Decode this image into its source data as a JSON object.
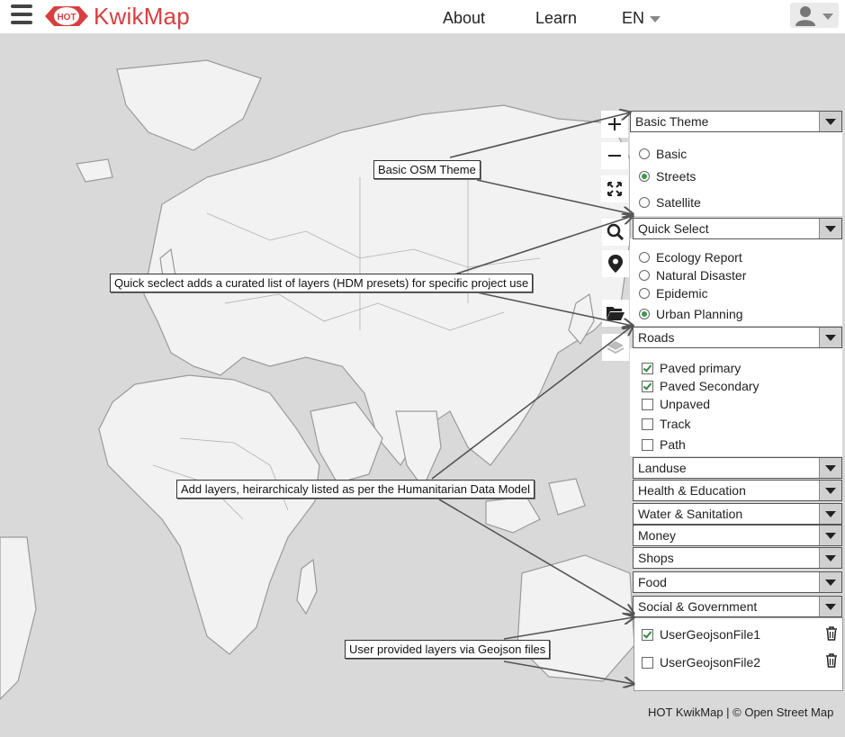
{
  "header": {
    "brand": "KwikMap",
    "badge": "HOT",
    "nav": {
      "about": "About",
      "learn": "Learn",
      "language": "EN"
    }
  },
  "panel": {
    "theme_dropdown": "Basic Theme",
    "themes": [
      {
        "label": "Basic",
        "selected": false
      },
      {
        "label": "Streets",
        "selected": true
      },
      {
        "label": "Satellite",
        "selected": false
      }
    ],
    "quick_dropdown": "Quick Select",
    "quick_options": [
      {
        "label": "Ecology Report",
        "selected": false
      },
      {
        "label": "Natural Disaster",
        "selected": false
      },
      {
        "label": "Epidemic",
        "selected": false
      },
      {
        "label": "Urban Planning",
        "selected": true
      }
    ],
    "roads_dropdown": "Roads",
    "roads": [
      {
        "label": "Paved primary",
        "checked": true
      },
      {
        "label": "Paved Secondary",
        "checked": true
      },
      {
        "label": "Unpaved",
        "checked": false
      },
      {
        "label": "Track",
        "checked": false
      },
      {
        "label": "Path",
        "checked": false
      }
    ],
    "categories": [
      "Landuse",
      "Health & Education",
      "Water & Sanitation",
      "Money",
      "Shops",
      "Food",
      "Social & Government"
    ],
    "user_files": [
      {
        "label": "UserGeojsonFile1",
        "checked": true
      },
      {
        "label": "UserGeojsonFile2",
        "checked": false
      }
    ]
  },
  "callouts": {
    "theme": "Basic OSM Theme",
    "quick": "Quick seclect adds a curated list of layers (HDM presets) for specific project use",
    "layers": "Add layers, heirarchicaly listed as per the Humanitarian Data Model",
    "user": "User provided layers via Geojson files"
  },
  "footer": "HOT KwikMap | © Open Street Map",
  "colors": {
    "brand": "#d73f3f",
    "map_land": "#f2f2f2",
    "map_water": "#d9d9d9",
    "check_green": "#2e8b3c"
  }
}
